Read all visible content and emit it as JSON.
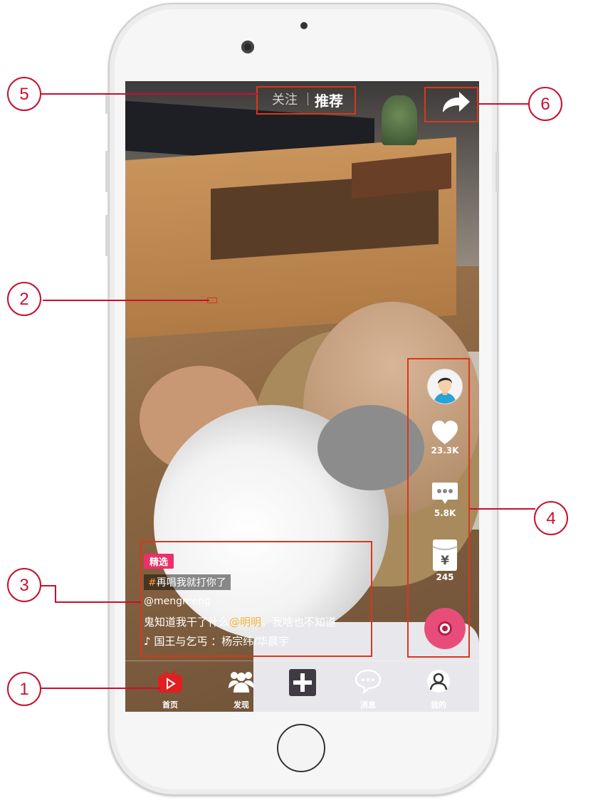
{
  "top_tabs": {
    "follow": "关注",
    "recommend": "推荐"
  },
  "actions": {
    "likes": "23.3K",
    "comments": "5.8K",
    "gifts": "245"
  },
  "caption": {
    "badge": "精选",
    "topic_hash": "#",
    "topic": "再唱我就打你了",
    "user": "@mengmeng",
    "desc_before": "鬼知道我干了什么",
    "mention": "@明明",
    "desc_after": "，我啥也不知道",
    "music": "♪ 国王与乞丐 ：杨宗纬/华晨宇"
  },
  "nav": {
    "home": "首页",
    "discover": "发现",
    "messages": "消息",
    "me": "我的"
  },
  "callouts": [
    "1",
    "2",
    "3",
    "4",
    "5",
    "6"
  ],
  "colors": {
    "accent": "#ee2f6a",
    "annotation": "#c8102e",
    "mention": "#f5b43c",
    "home_active": "#e02020"
  },
  "icons": [
    "share-icon",
    "heart-icon",
    "comment-icon",
    "gift-icon",
    "music-disc-icon",
    "home-tv-icon",
    "discover-people-icon",
    "add-icon",
    "message-icon",
    "profile-icon"
  ]
}
